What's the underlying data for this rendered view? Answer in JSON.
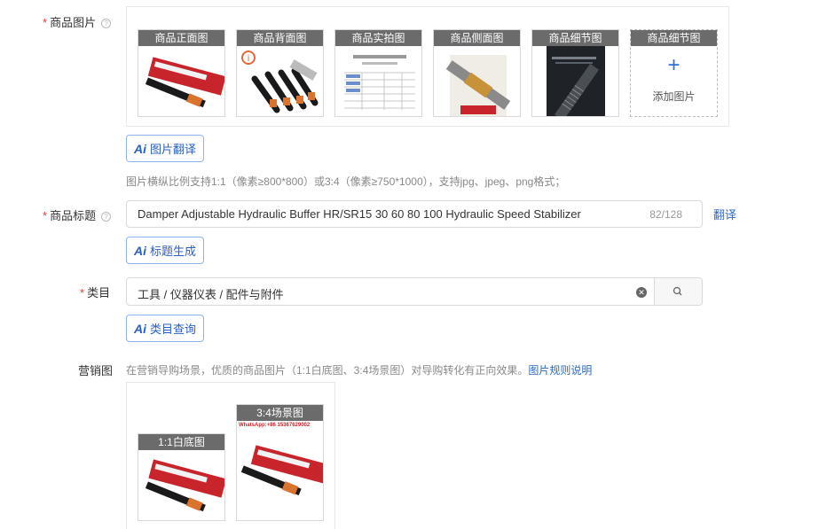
{
  "product_images": {
    "label": "商品图片",
    "required": "*",
    "help_icon": "question-circle-icon",
    "thumbs": [
      {
        "tag": "商品正面图"
      },
      {
        "tag": "商品背面图"
      },
      {
        "tag": "商品实拍图"
      },
      {
        "tag": "商品侧面图"
      },
      {
        "tag": "商品细节图"
      }
    ],
    "add_slot": {
      "tag": "商品细节图",
      "plus": "+",
      "label": "添加图片"
    },
    "ai_button": {
      "icon": "Ai",
      "label": "图片翻译"
    },
    "hint": "图片横纵比例支持1:1（像素≥800*800）或3:4（像素≥750*1000），支持jpg、jpeg、png格式；"
  },
  "product_title": {
    "label": "商品标题",
    "required": "*",
    "value": "Damper Adjustable Hydraulic Buffer HR/SR15 30 60 80 100 Hydraulic Speed Stabilizer",
    "count": "82/128",
    "translate_link": "翻译",
    "ai_button": {
      "icon": "Ai",
      "label": "标题生成"
    }
  },
  "category": {
    "label": "类目",
    "required": "*",
    "value": "工具 / 仪器仪表 / 配件与附件",
    "clear_icon": "close-circle-icon",
    "search_icon": "search-icon",
    "ai_button": {
      "icon": "Ai",
      "label": "类目查询"
    }
  },
  "marketing": {
    "label": "营销图",
    "hint": "在营销导购场景，优质的商品图片（1:1白底图、3:4场景图）对导购转化有正向效果。",
    "rules_link": "图片规则说明",
    "thumbs": [
      {
        "tag": "1:1白底图"
      },
      {
        "tag": "3:4场景图",
        "watermark": "WhatsApp:+86 15367629002"
      }
    ]
  },
  "colors": {
    "accent": "#2a6ac8",
    "required": "#e4393c",
    "tag_bg": "#6b6b6b",
    "product_orange": "#d9732e",
    "product_red": "#c8242c"
  }
}
